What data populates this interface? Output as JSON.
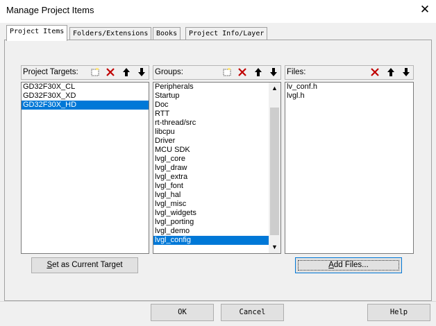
{
  "window": {
    "title": "Manage Project Items",
    "close_glyph": "✕"
  },
  "tabs": [
    {
      "label": "Project Items",
      "active": true
    },
    {
      "label": "Folders/Extensions",
      "active": false
    },
    {
      "label": "Books",
      "active": false
    },
    {
      "label": "Project Info/Layer",
      "active": false
    }
  ],
  "targets": {
    "label": "Project Targets:",
    "items": [
      "GD32F30X_CL",
      "GD32F30X_XD",
      "GD32F30X_HD"
    ],
    "selected_index": 2,
    "button_label": "Set as Current Target",
    "button_mnemonic": "S",
    "button_rest": "et as Current Target"
  },
  "groups": {
    "label": "Groups:",
    "items": [
      "Peripherals",
      "Startup",
      "Doc",
      "RTT",
      "rt-thread/src",
      "libcpu",
      "Driver",
      "MCU SDK",
      "lvgl_core",
      "lvgl_draw",
      "lvgl_extra",
      "lvgl_font",
      "lvgl_hal",
      "lvgl_misc",
      "lvgl_widgets",
      "lvgl_porting",
      "lvgl_demo",
      "lvgl_config"
    ],
    "selected_index": 17
  },
  "files": {
    "label": "Files:",
    "items": [
      "lv_conf.h",
      "lvgl.h"
    ],
    "button_label": "Add Files...",
    "button_mnemonic": "A",
    "button_rest": "dd Files..."
  },
  "footer": {
    "ok": "OK",
    "cancel": "Cancel",
    "help": "Help"
  },
  "icons": {
    "new": "new-item-icon",
    "delete": "delete-icon",
    "up": "move-up-icon",
    "down": "move-down-icon"
  },
  "colors": {
    "selection": "#0078d7",
    "delete_red": "#c00000",
    "new_yellow": "#ffe680"
  }
}
